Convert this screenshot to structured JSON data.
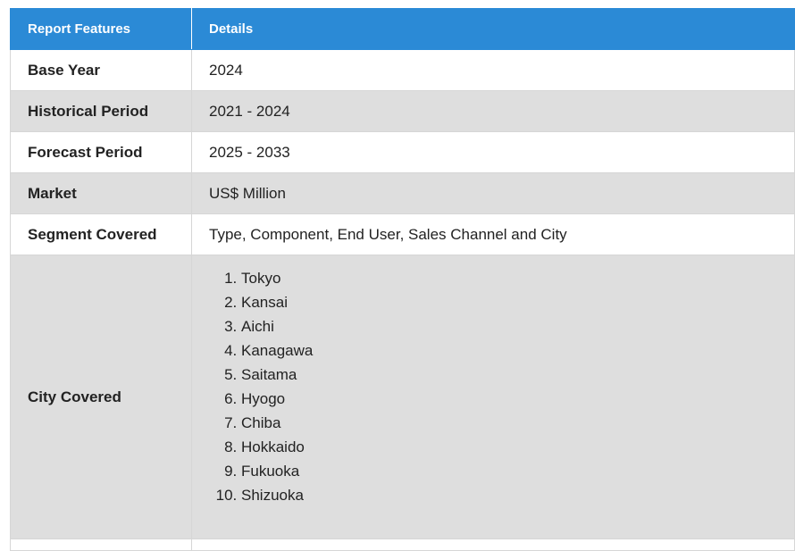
{
  "table": {
    "headers": [
      "Report Features",
      "Details"
    ],
    "rows": [
      {
        "feature": "Base Year",
        "detail": "2024"
      },
      {
        "feature": "Historical Period",
        "detail": "2021 - 2024"
      },
      {
        "feature": "Forecast Period",
        "detail": "2025 - 2033"
      },
      {
        "feature": "Market",
        "detail": "US$ Million"
      },
      {
        "feature": "Segment Covered",
        "detail": "Type, Component, End User, Sales Channel and City"
      },
      {
        "feature": "City Covered",
        "cities": [
          "Tokyo",
          "Kansai",
          "Aichi",
          "Kanagawa",
          "Saitama",
          "Hyogo",
          "Chiba",
          "Hokkaido",
          "Fukuoka",
          "Shizuoka"
        ]
      }
    ]
  }
}
